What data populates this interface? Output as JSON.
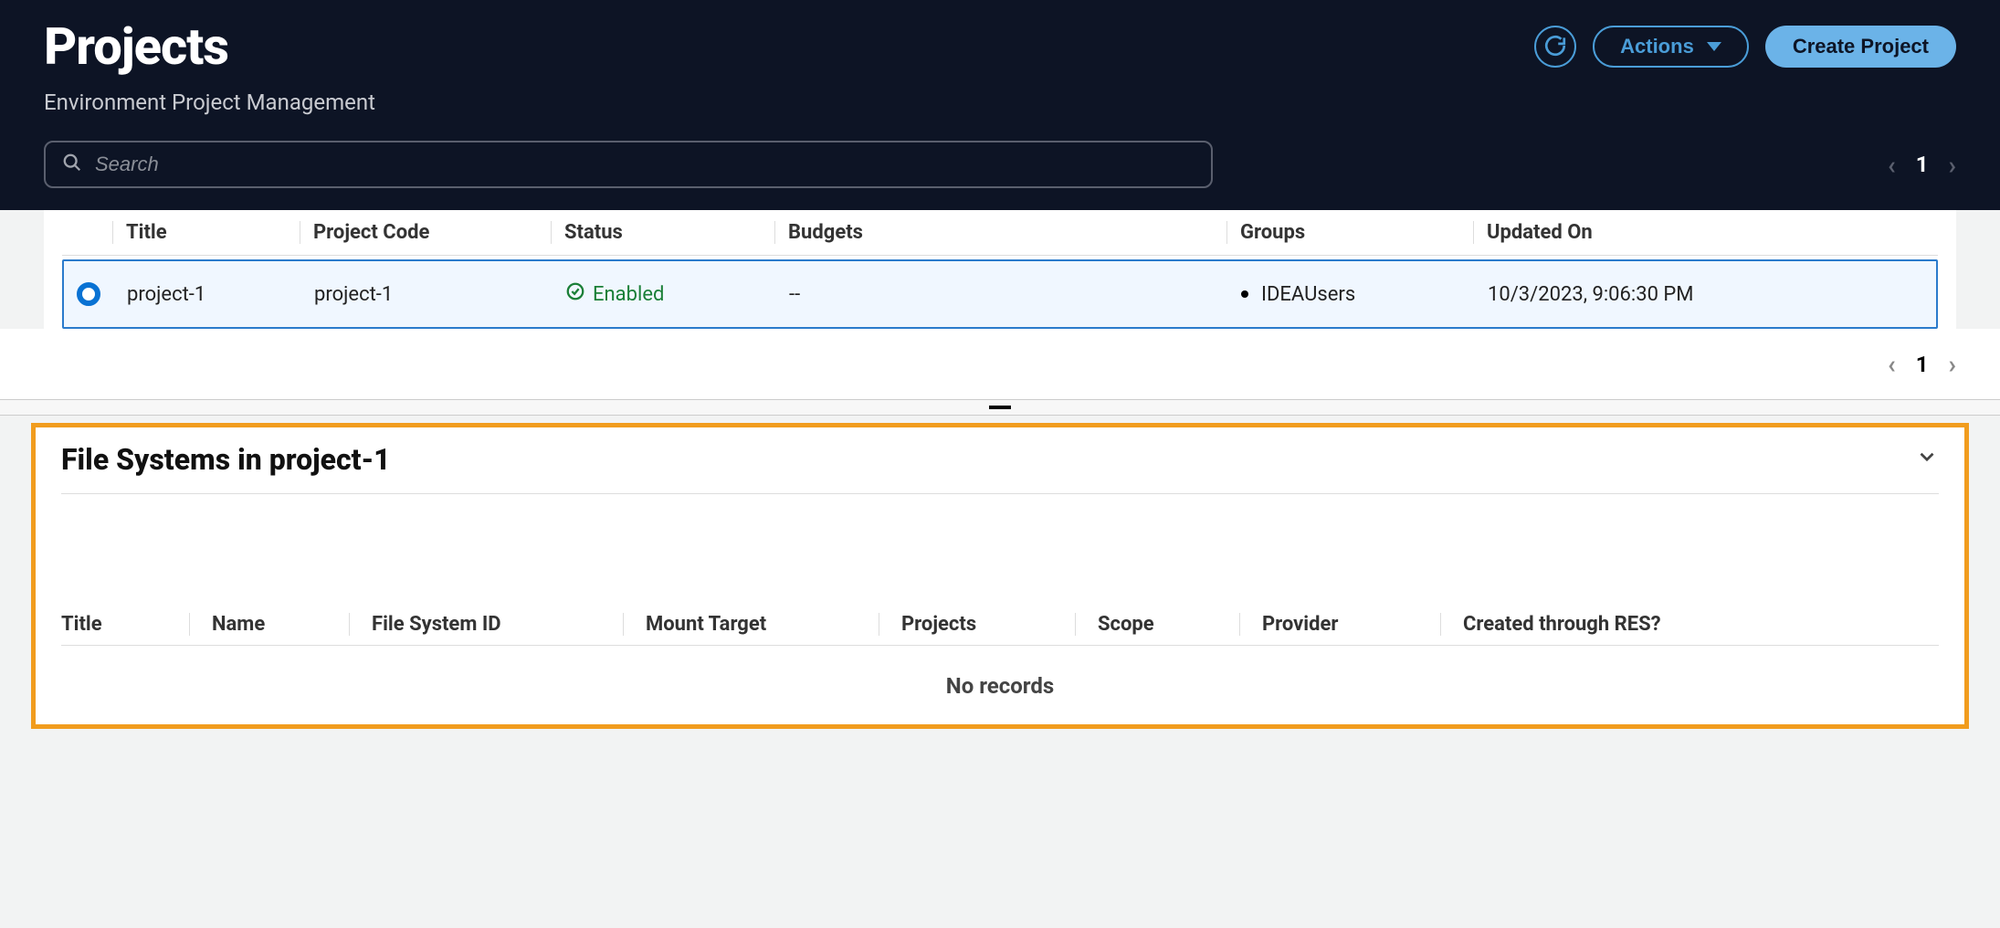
{
  "header": {
    "title": "Projects",
    "subtitle": "Environment Project Management",
    "actions_label": "Actions",
    "create_label": "Create Project"
  },
  "search": {
    "placeholder": "Search"
  },
  "pagination": {
    "top_page": "1",
    "bottom_page": "1"
  },
  "projects_table": {
    "columns": {
      "title": "Title",
      "code": "Project Code",
      "status": "Status",
      "budgets": "Budgets",
      "groups": "Groups",
      "updated": "Updated On"
    },
    "rows": [
      {
        "title": "project-1",
        "code": "project-1",
        "status": "Enabled",
        "budgets": "--",
        "groups": "IDEAUsers",
        "updated": "10/3/2023, 9:06:30 PM"
      }
    ]
  },
  "detail": {
    "title": "File Systems in project-1",
    "columns": {
      "title": "Title",
      "name": "Name",
      "fsid": "File System ID",
      "mount": "Mount Target",
      "projects": "Projects",
      "scope": "Scope",
      "provider": "Provider",
      "created": "Created through RES?"
    },
    "empty": "No records"
  }
}
